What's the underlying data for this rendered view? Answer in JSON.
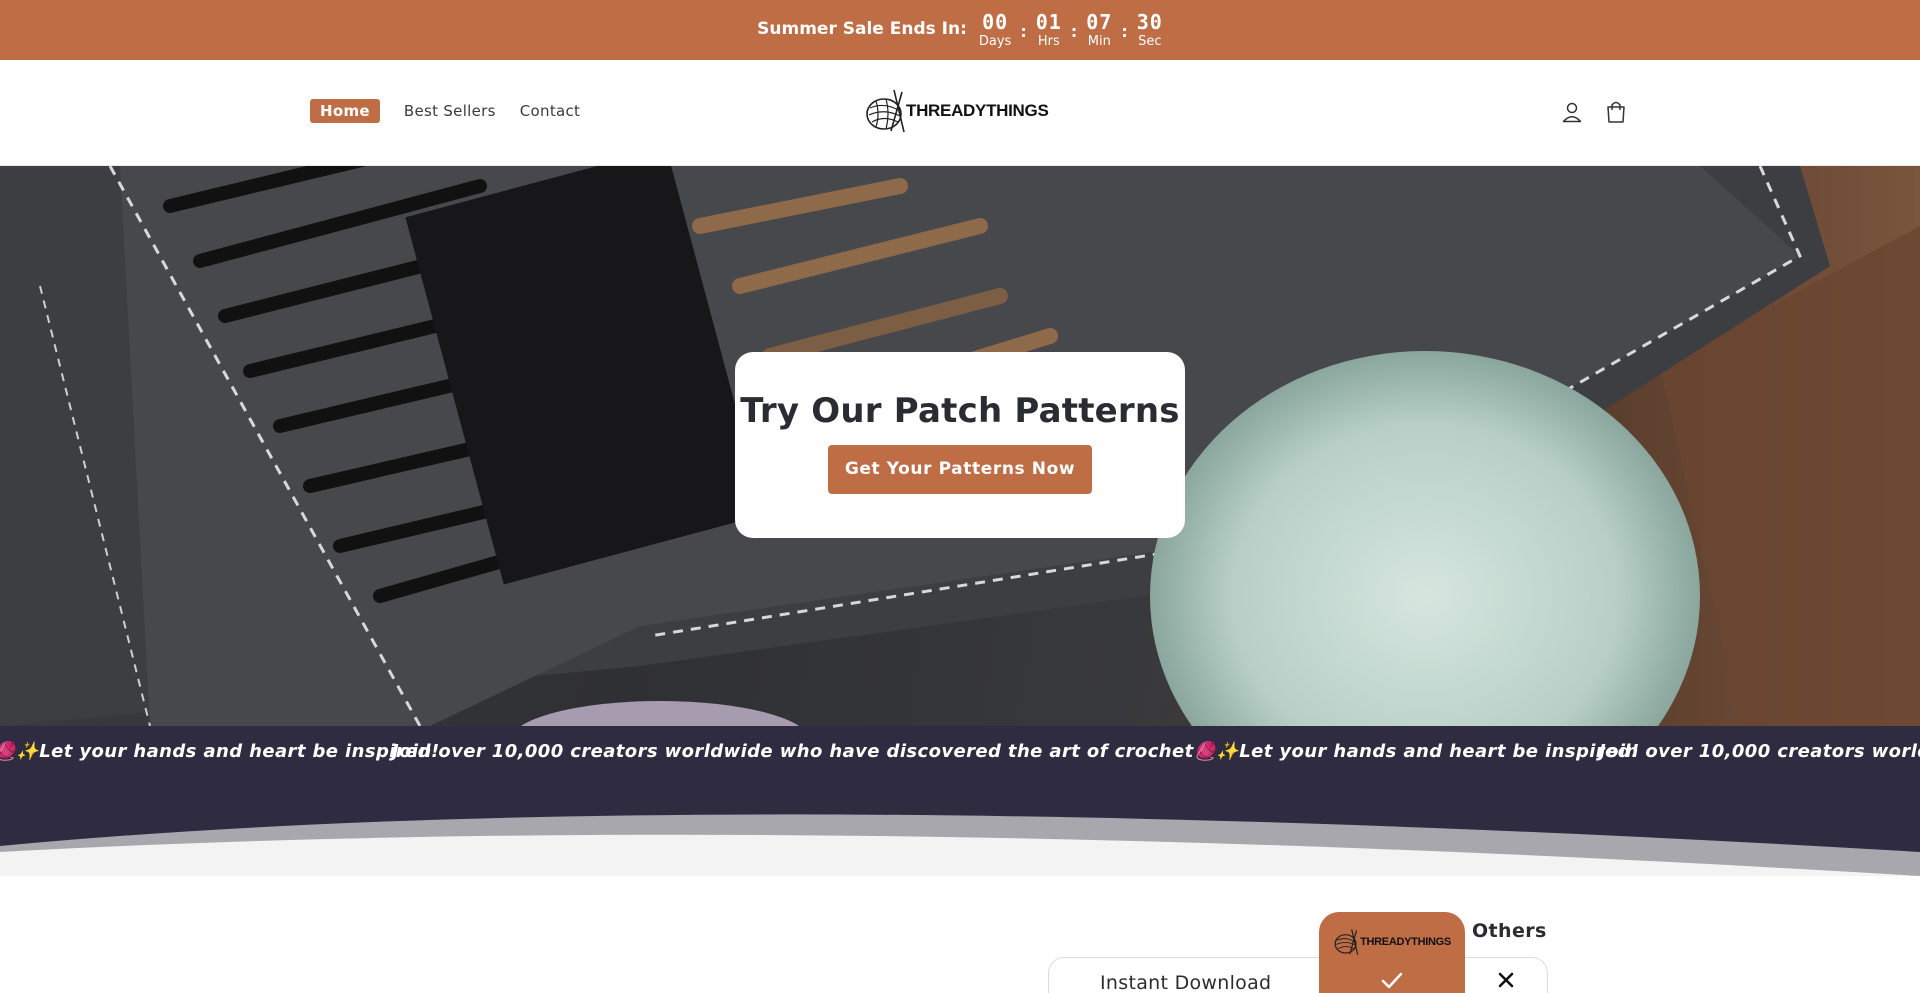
{
  "announcement": {
    "label": "Summer Sale Ends In:",
    "countdown": [
      {
        "value": "00",
        "unit": "Days"
      },
      {
        "value": "01",
        "unit": "Hrs"
      },
      {
        "value": "07",
        "unit": "Min"
      },
      {
        "value": "30",
        "unit": "Sec"
      }
    ],
    "separator": ":",
    "background": "#bf6d45"
  },
  "header": {
    "nav": [
      {
        "label": "Home",
        "active": true
      },
      {
        "label": "Best Sellers",
        "active": false
      },
      {
        "label": "Contact",
        "active": false
      }
    ],
    "logo_text": "THREADYTHINGS",
    "icons": [
      "account-icon",
      "cart-icon"
    ]
  },
  "hero": {
    "title": "Try Our Patch Patterns",
    "button_label": "Get Your Patterns Now"
  },
  "marquee": {
    "text": "Join over 10,000 creators worldwide who have discovered the art of crochet🧶✨Let your hands and heart be inspired!",
    "background": "#2f2c41"
  },
  "comparison": {
    "column_others": "Others",
    "brand_logo_text": "THREADYTHINGS",
    "rows": [
      {
        "label": "Instant Download",
        "brand": "check-icon",
        "others": "close-icon"
      }
    ]
  },
  "colors": {
    "accent": "#bf6d45",
    "dark": "#2f2c41"
  }
}
